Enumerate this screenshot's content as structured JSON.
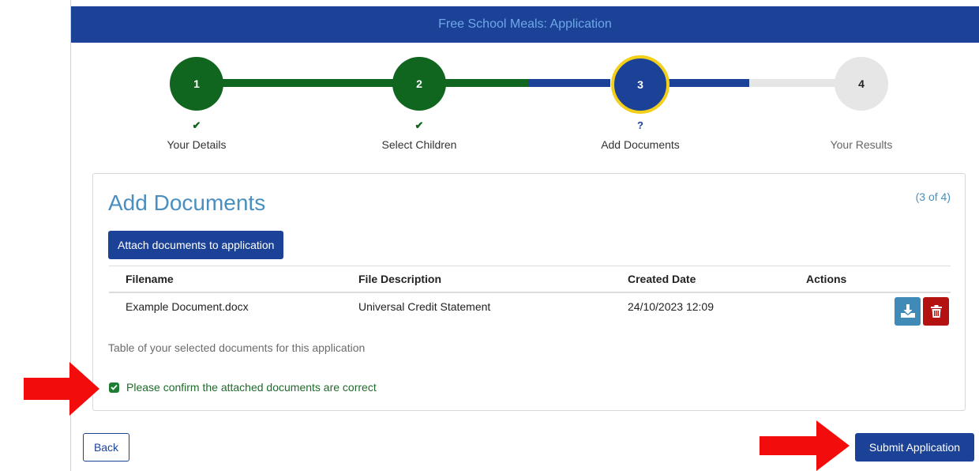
{
  "banner": {
    "title": "Free School Meals: Application"
  },
  "stepper": {
    "steps": [
      {
        "number": "1",
        "status_mark": "✔",
        "label": "Your Details",
        "state": "complete"
      },
      {
        "number": "2",
        "status_mark": "✔",
        "label": "Select Children",
        "state": "complete"
      },
      {
        "number": "3",
        "status_mark": "?",
        "label": "Add Documents",
        "state": "current"
      },
      {
        "number": "4",
        "status_mark": "",
        "label": "Your Results",
        "state": "pending"
      }
    ]
  },
  "card": {
    "title": "Add Documents",
    "progress": "(3 of 4)",
    "attach_button": "Attach documents to application",
    "table": {
      "headers": [
        "Filename",
        "File Description",
        "Created Date",
        "Actions"
      ],
      "rows": [
        {
          "filename": "Example Document.docx",
          "description": "Universal Credit Statement",
          "created": "24/10/2023 12:09",
          "actions": [
            "download-icon",
            "trash-icon"
          ]
        }
      ]
    },
    "caption": "Table of your selected documents for this application",
    "confirm_label": "Please confirm the attached documents are correct",
    "confirm_checked": true
  },
  "footer": {
    "back_label": "Back",
    "submit_label": "Submit Application"
  },
  "colors": {
    "brand_blue": "#1b4297",
    "complete_green": "#11661f",
    "current_ring": "#f2cf1b",
    "pending_grey": "#e6e6e6",
    "danger_red": "#b41111",
    "link_blue": "#4a8fbf"
  }
}
